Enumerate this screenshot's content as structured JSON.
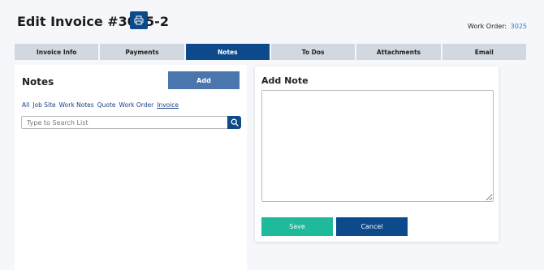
{
  "header": {
    "title": "Edit Invoice #3025-2",
    "print_icon": "printer-icon",
    "work_order_label": "Work Order:",
    "work_order_value": "3025"
  },
  "tabs": [
    {
      "label": "Invoice Info",
      "active": false
    },
    {
      "label": "Payments",
      "active": false
    },
    {
      "label": "Notes",
      "active": true
    },
    {
      "label": "To Dos",
      "active": false
    },
    {
      "label": "Attachments",
      "active": false
    },
    {
      "label": "Email",
      "active": false
    }
  ],
  "notes": {
    "title": "Notes",
    "add_label": "Add",
    "filters": [
      {
        "label": "All",
        "active": false
      },
      {
        "label": "Job Site",
        "active": false
      },
      {
        "label": "Work Notes",
        "active": false
      },
      {
        "label": "Quote",
        "active": false
      },
      {
        "label": "Work Order",
        "active": false
      },
      {
        "label": "Invoice",
        "active": true
      }
    ],
    "search_placeholder": "Type to Search List",
    "search_icon": "search-icon"
  },
  "add_note": {
    "title": "Add Note",
    "textarea_value": "",
    "save_label": "Save",
    "cancel_label": "Cancel"
  },
  "colors": {
    "primary": "#0d4a8c",
    "add_button": "#4a76ad",
    "save_button": "#1fb99b",
    "tab_inactive": "#d2d8df",
    "link": "#2a7bd3"
  }
}
